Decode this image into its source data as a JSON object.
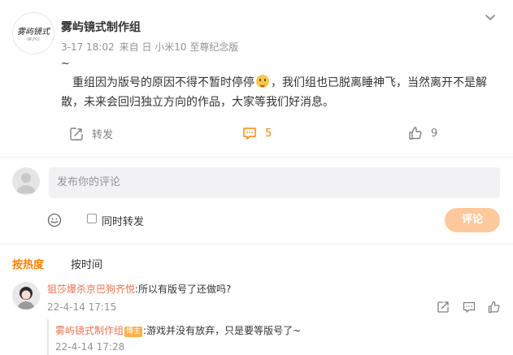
{
  "post": {
    "author": "雾屿镜式制作组",
    "avatar_logo": "雾屿镜式",
    "avatar_logo_sub": "WUYU",
    "date": "3-17 18:02",
    "source": "来自 日 小米10 至尊纪念版",
    "tilde": "~",
    "text_part1": "重组因为版号的原因不得不暂时停停",
    "text_part2": "，我们组也已脱离睡神飞，当然离开不是解散，未来会回归独立方向的作品，大家等我们好消息。",
    "emoji_icon": "smiling-face-icon"
  },
  "actions": {
    "repost_label": "转发",
    "comment_count": "5",
    "like_count": "9"
  },
  "comment_input": {
    "placeholder": "发布你的评论",
    "also_repost_label": "同时转发",
    "submit_label": "评论"
  },
  "sort_tabs": {
    "hot": "按热度",
    "time": "按时间"
  },
  "comments": [
    {
      "user": "狙莎爆杀京巴狗齐悦",
      "text": ":所以有版号了还做吗?",
      "date": "22-4-14 17:15",
      "replies": [
        {
          "user": "雾屿镜式制作组",
          "badge": "博主",
          "text": ":游戏并没有放弃，只是要等版号了~",
          "date": "22-4-14 17:28"
        }
      ]
    }
  ],
  "colors": {
    "accent": "#ff8200",
    "username": "#eb7350",
    "submit_disabled": "#fec89d",
    "muted": "#939393"
  }
}
